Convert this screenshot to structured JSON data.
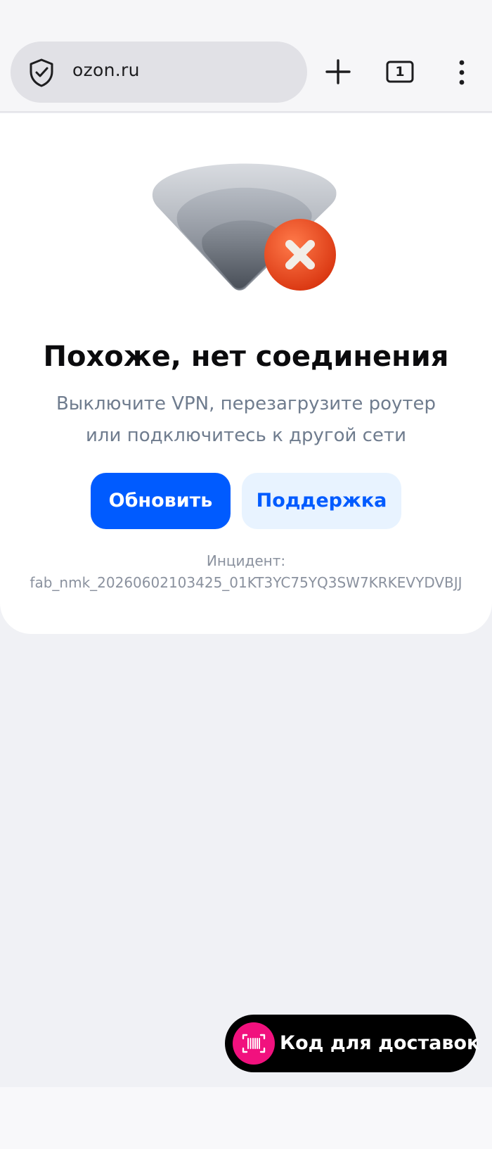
{
  "browser": {
    "url": "ozon.ru",
    "tab_count": "1",
    "icons": {
      "site_info": "shield-check-icon",
      "new_tab": "plus-icon",
      "tabs": "tabs-icon",
      "menu": "more-vert-icon"
    }
  },
  "error": {
    "title": "Похоже, нет соединения",
    "description_line1": "Выключите VPN, перезагрузите роутер",
    "description_line2": "или подключитесь к другой сети",
    "refresh_label": "Обновить",
    "support_label": "Поддержка",
    "incident_label": "Инцидент:",
    "incident_id": "fab_nmk_20260602103425_01KT3YC75YQ3SW7KRKEVYDVBJJ",
    "illustration": "wifi-error-icon"
  },
  "delivery": {
    "label": "Код для доставок",
    "icon": "barcode-scan-icon"
  },
  "colors": {
    "accent": "#005bff",
    "accent_soft": "#e8f3ff",
    "badge_pink": "#f1117e",
    "error_red": "#f0451f",
    "page_background": "#f0f1f5"
  }
}
